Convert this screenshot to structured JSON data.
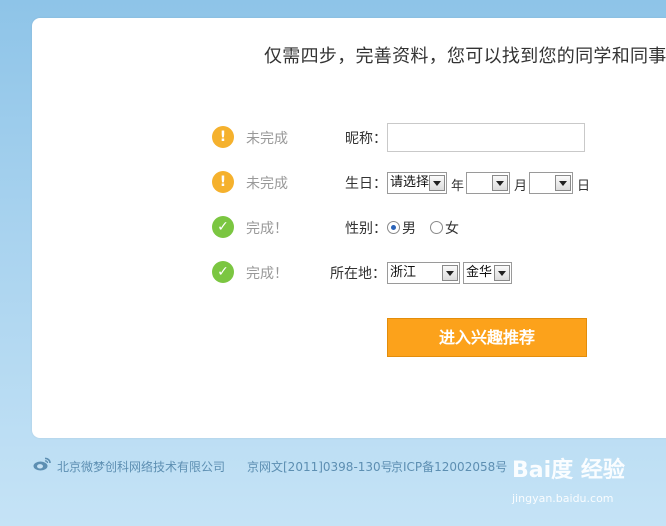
{
  "headline": "仅需四步，完善资料，您可以找到您的同学和同事了",
  "rows": [
    {
      "status_icon": "!",
      "status": "未完成",
      "label": "昵称："
    },
    {
      "status_icon": "!",
      "status": "未完成",
      "label": "生日："
    },
    {
      "status_icon": "✓",
      "status": "完成！",
      "label": "性别："
    },
    {
      "status_icon": "✓",
      "status": "完成！",
      "label": "所在地："
    }
  ],
  "birthday": {
    "year_value": "请选择",
    "year_unit": "年",
    "month_value": "",
    "month_unit": "月",
    "day_value": "",
    "day_unit": "日"
  },
  "gender": {
    "male": "男",
    "female": "女",
    "selected": "男"
  },
  "location": {
    "province": "浙江",
    "city": "金华"
  },
  "submit_label": "进入兴趣推荐",
  "footer": {
    "company": "北京微梦创科网络技术有限公司",
    "license1": "京网文[2011]0398-130号",
    "license2": "京ICP备12002058号"
  },
  "watermark": {
    "logo_text": "Bai度 经验",
    "url": "jingyan.baidu.com"
  },
  "colors": {
    "warn": "#f5b12d",
    "ok": "#7bc641",
    "button": "#fca21b"
  }
}
